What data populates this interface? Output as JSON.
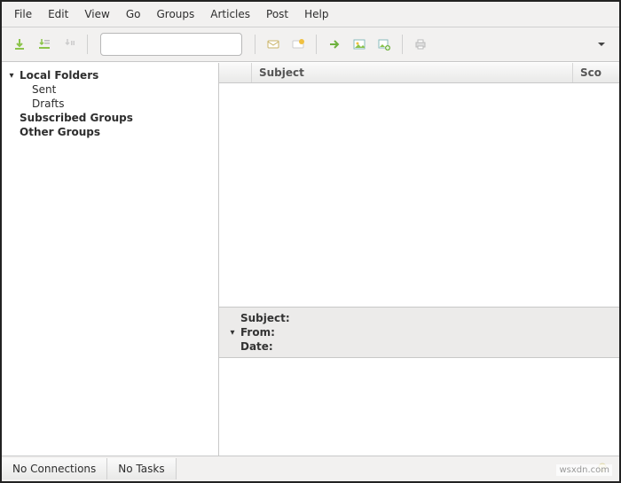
{
  "menubar": {
    "items": [
      "File",
      "Edit",
      "View",
      "Go",
      "Groups",
      "Articles",
      "Post",
      "Help"
    ]
  },
  "toolbar": {
    "icons": {
      "download1": "download-green-icon",
      "download2": "download-list-icon",
      "download3": "download-pause-icon",
      "search": "search-icon",
      "clear": "clear-icon",
      "mail1": "mail-mark-icon",
      "mail2": "mail-flag-icon",
      "forward": "forward-icon",
      "image1": "image-icon",
      "image2": "image-add-icon",
      "print": "print-icon",
      "menu": "dropdown-icon"
    },
    "search_placeholder": ""
  },
  "sidebar": {
    "local_folders": {
      "label": "Local Folders",
      "expanded": true
    },
    "sent": {
      "label": "Sent"
    },
    "drafts": {
      "label": "Drafts"
    },
    "subscribed": {
      "label": "Subscribed Groups"
    },
    "other": {
      "label": "Other Groups"
    }
  },
  "columns": {
    "subject": "Subject",
    "score": "Sco"
  },
  "message_meta": {
    "subject_label": "Subject:",
    "from_label": "From:",
    "date_label": "Date:"
  },
  "statusbar": {
    "connections": "No Connections",
    "tasks": "No Tasks"
  },
  "watermark": "wsxdn.com"
}
